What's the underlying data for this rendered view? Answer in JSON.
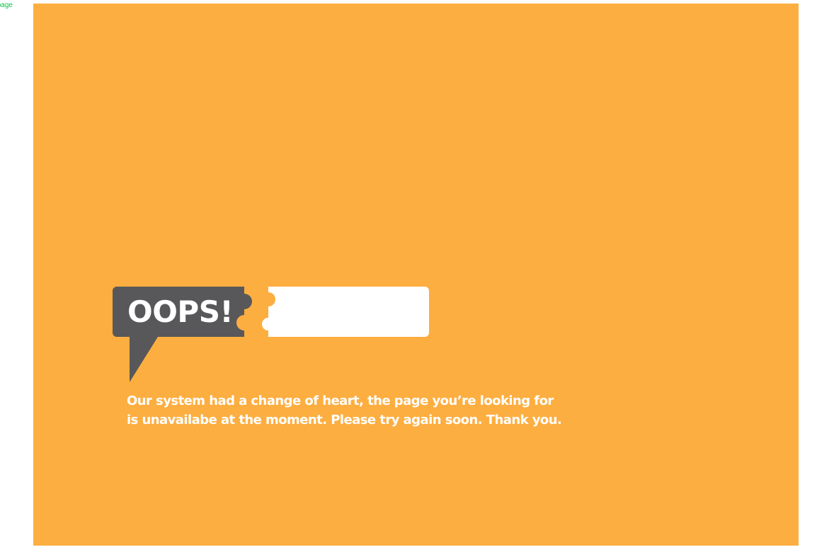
{
  "corner_label": "page",
  "oops": {
    "title": "OOPS!"
  },
  "message": {
    "line1": "Our system had a change of heart, the page you’re looking for",
    "line2": "is unavailabe at the moment. Please try again soon. Thank you."
  },
  "colors": {
    "background": "#FDAE40",
    "bubble": "#58585A",
    "text": "#FFFFFF",
    "corner_label": "#10C24A"
  },
  "icons": {
    "speech_bubble": "speech-bubble-icon",
    "puzzle_piece": "puzzle-piece-icon"
  }
}
